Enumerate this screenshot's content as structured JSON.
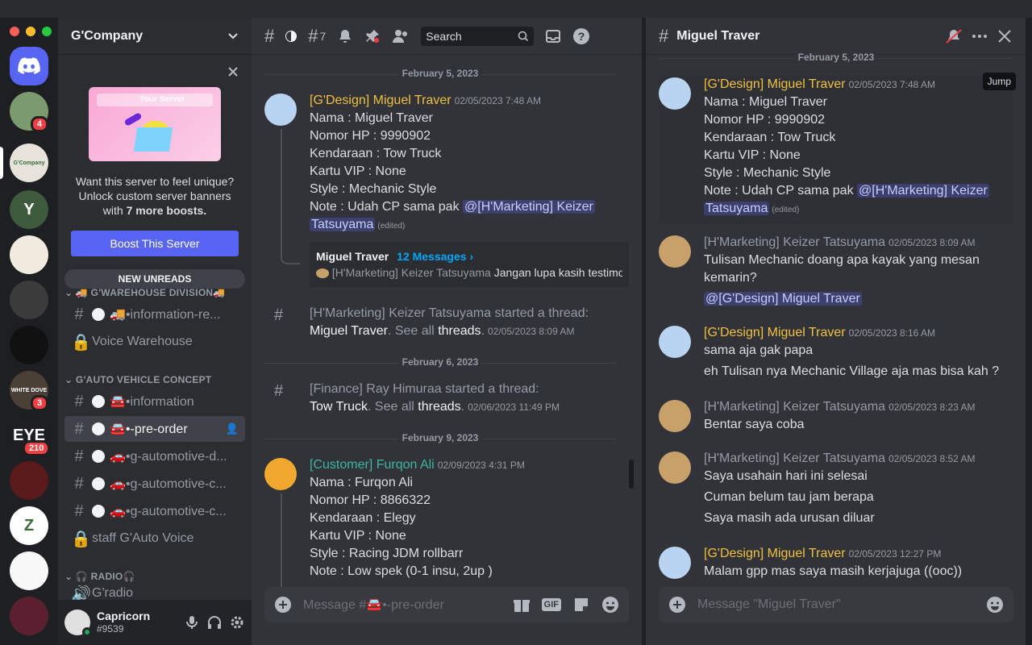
{
  "colors": {
    "yellow": "#f0c040",
    "teal": "#3ab8a0",
    "accent": "#5865f2",
    "link": "#00a8fc"
  },
  "servers": [
    {
      "label": "",
      "badge": "4",
      "color": "#7b9b6f"
    },
    {
      "label": "G'Company",
      "badge": "",
      "color": "#e8e4dc"
    },
    {
      "label": "Y",
      "badge": "",
      "color": "#3d5a3d"
    },
    {
      "label": "",
      "badge": "",
      "color": "#f2ebe0"
    },
    {
      "label": "",
      "badge": "",
      "color": "#3b3b3b"
    },
    {
      "label": "",
      "badge": "",
      "color": "#111111"
    },
    {
      "label": "WHITE DOVE",
      "badge": "3",
      "color": "#4a4035"
    },
    {
      "label": "EYE",
      "badge": "210",
      "color": "#1e1f22"
    },
    {
      "label": "",
      "badge": "",
      "color": "#5a1a1a"
    },
    {
      "label": "Z",
      "badge": "",
      "color": "#ffffff"
    },
    {
      "label": "",
      "badge": "",
      "color": "#f8f8f8"
    },
    {
      "label": "",
      "badge": "",
      "color": "#5b2030"
    }
  ],
  "sidebar": {
    "server_name": "G'Company",
    "boost": {
      "banner_text": "Your Server",
      "line1": "Want this server to feel unique?",
      "line2": "Unlock custom server banners",
      "line3_pre": "with ",
      "line3_bold": "7 more boosts.",
      "button": "Boost This Server"
    },
    "new_unreads": "NEW UNREADS",
    "cat1": "🚚 G'WAREHOUSE DIVISION🚚",
    "ch_info_re": "🚚•information-re...",
    "voice_warehouse": "Voice Warehouse",
    "cat2": "G'AUTO VEHICLE CONCEPT",
    "ch_information": "🚘•information",
    "ch_preorder": "🚘•-pre-order",
    "ch_auto_d": "🚗•g-automotive-d...",
    "ch_auto_c1": "🚗•g-automotive-c...",
    "ch_auto_c2": "🚗•g-automotive-c...",
    "staff_voice": "staff G'Auto Voice",
    "cat3": "🎧 RADIO🎧",
    "radio_ch": "G'radio",
    "user_name": "Capricorn",
    "user_tag": "#9539"
  },
  "chat": {
    "thread_count": "7",
    "search_placeholder": "Search",
    "date1": "February 5, 2023",
    "date2": "February 6, 2023",
    "date3": "February 9, 2023",
    "m1": {
      "author": "[G'Design] Miguel Traver",
      "time": "02/05/2023 7:48 AM",
      "lines": [
        "Nama : Miguel Traver",
        "Nomor HP : 9990902",
        "Kendaraan : Tow Truck",
        "Kartu VIP : None",
        "Style : Mechanic Style"
      ],
      "note_pre": "Note : Udah CP sama pak ",
      "mention_a": "@[H'Marketing] Keizer",
      "mention_b": "Tatsuyama",
      "edited": "(edited)",
      "thread_name": "Miguel Traver",
      "thread_count": "12 Messages ›",
      "thread_last_author": "[H'Marketing] Keizer Tatsuyama",
      "thread_last_text": "Jangan lupa kasih testimoni"
    },
    "s1": {
      "actor": "[H'Marketing] Keizer Tatsuyama",
      "action": " started a thread:",
      "thread": "Miguel Traver",
      "see_all": ". See all ",
      "threads": "threads",
      "suffix": ".",
      "time": "02/05/2023 8:09 AM"
    },
    "s2": {
      "actor": "[Finance] Ray Himuraa",
      "action": " started a thread:",
      "thread": "Tow Truck",
      "see_all": ". See all ",
      "threads": "threads",
      "suffix": ".",
      "time": "02/06/2023 11:49 PM"
    },
    "m2": {
      "author": "[Customer] Furqon Ali",
      "time": "02/09/2023 4:31 PM",
      "lines": [
        "Nama : Furqon Ali",
        "Nomor HP : 8866322",
        "Kendaraan : Elegy",
        "Kartu VIP : None",
        "Style : Racing JDM rollbarr",
        "Note : Low spek (0-1 insu, 2up )"
      ]
    },
    "composer_pre": "Message #",
    "composer_ch": "🚘•-pre-order",
    "gif": "GIF"
  },
  "thread": {
    "title": "Miguel Traver",
    "date": "February 5, 2023",
    "jump": "Jump",
    "t1": {
      "author": "[G'Design] Miguel Traver",
      "time": "02/05/2023 7:48 AM",
      "lines": [
        "Nama : Miguel Traver",
        "Nomor HP : 9990902",
        "Kendaraan : Tow Truck",
        "Kartu VIP : None",
        "Style : Mechanic Style"
      ],
      "note_pre": "Note : Udah CP sama pak ",
      "mention_a": "@[H'Marketing] Keizer",
      "mention_b": "Tatsuyama",
      "edited": "(edited)"
    },
    "t2": {
      "author": "[H'Marketing] Keizer Tatsuyama",
      "time": "02/05/2023 8:09 AM",
      "l1": "Tulisan Mechanic doang apa kayak yang mesan",
      "l2": "kemarin?",
      "mention": "@[G'Design] Miguel Traver"
    },
    "t3": {
      "author": "[G'Design] Miguel Traver",
      "time": "02/05/2023 8:16 AM",
      "l1": "sama aja gak papa",
      "l2": "eh Tulisan nya Mechanic Village aja mas bisa kah ?"
    },
    "t4": {
      "author": "[H'Marketing] Keizer Tatsuyama",
      "time": "02/05/2023 8:23 AM",
      "l1": "Bentar saya coba"
    },
    "t5": {
      "author": "[H'Marketing] Keizer Tatsuyama",
      "time": "02/05/2023 8:52 AM",
      "l1": "Saya usahain hari ini selesai",
      "l2": "Cuman belum tau jam berapa",
      "l3": "Saya masih ada urusan diluar"
    },
    "t6": {
      "author": "[G'Design] Miguel Traver",
      "time": "02/05/2023 12:27 PM",
      "l1": "Malam gpp mas saya masih kerjajuga ((ooc))"
    },
    "composer": "Message \"Miguel Traver\""
  }
}
